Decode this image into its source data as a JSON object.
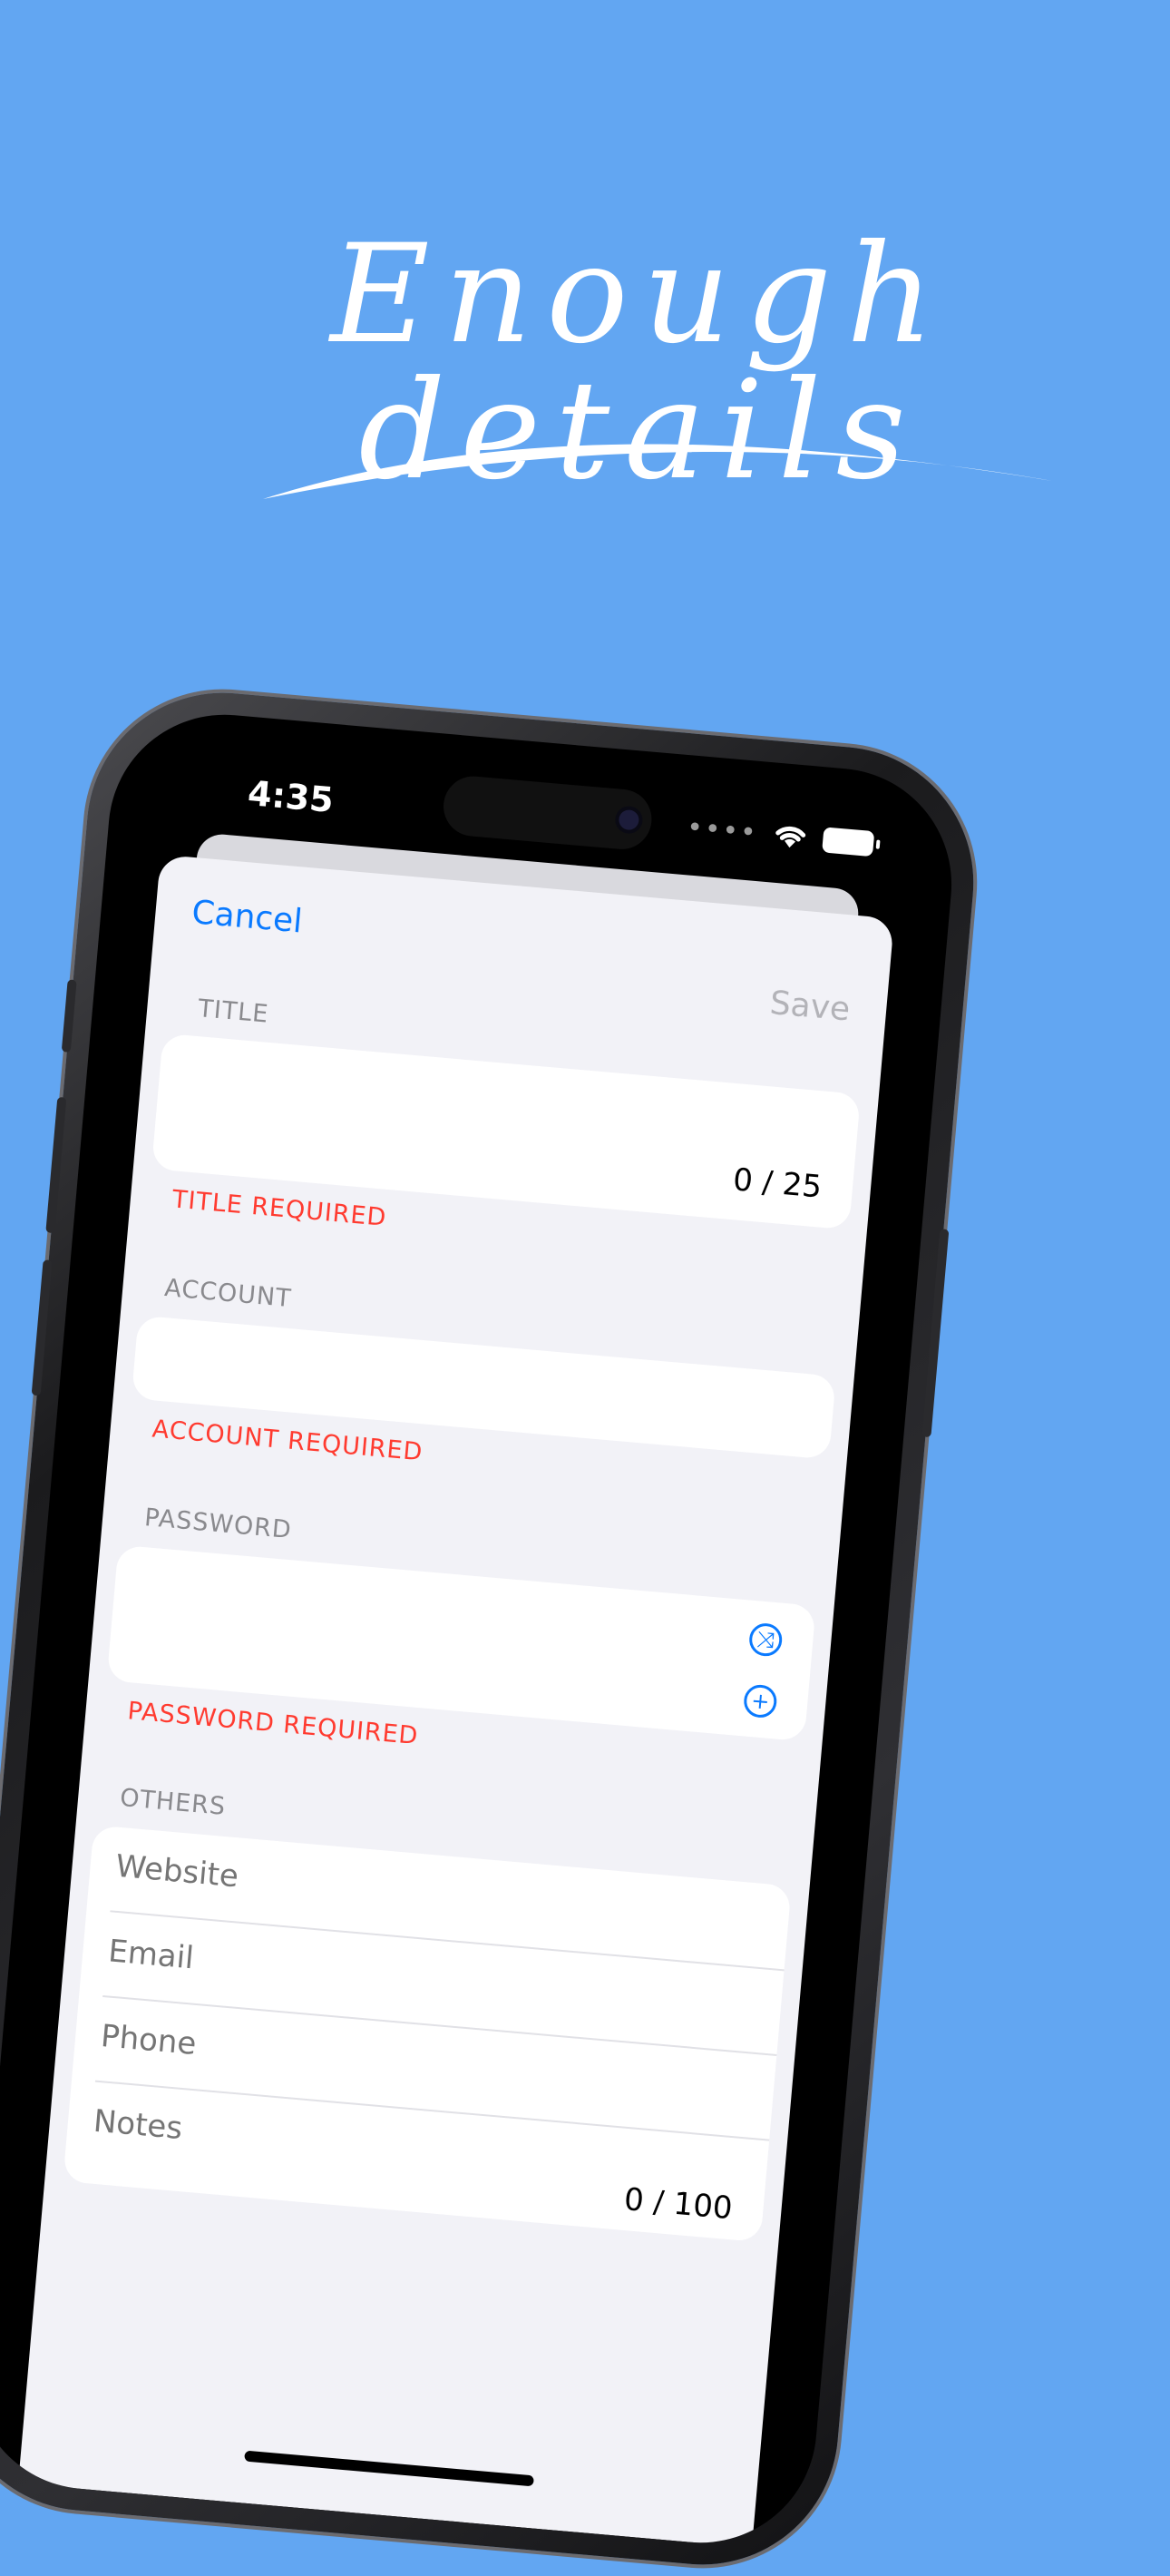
{
  "headline": "Enough details",
  "status_bar": {
    "time": "4:35",
    "signal_dots": "••••"
  },
  "nav": {
    "cancel_label": "Cancel",
    "save_label": "Save"
  },
  "title_section": {
    "label": "TITLE",
    "counter": "0 / 25",
    "error": "TITLE REQUIRED"
  },
  "account_section": {
    "label": "ACCOUNT",
    "error": "ACCOUNT REQUIRED"
  },
  "password_section": {
    "label": "PASSWORD",
    "error": "PASSWORD REQUIRED",
    "shuffle_icon": "shuffle-icon",
    "add_icon": "plus-circle-icon"
  },
  "others_section": {
    "label": "OTHERS",
    "website_placeholder": "Website",
    "email_placeholder": "Email",
    "phone_placeholder": "Phone",
    "notes_placeholder": "Notes",
    "notes_counter": "0 / 100"
  },
  "colors": {
    "background": "#62a6f2",
    "accent": "#0a7aff",
    "error": "#ff3b30"
  }
}
